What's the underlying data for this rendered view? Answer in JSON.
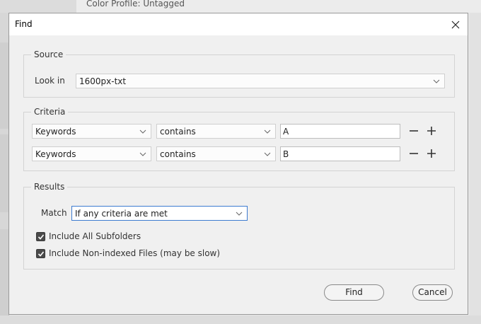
{
  "background": {
    "top_text": "Color Profile: Untagged"
  },
  "dialog": {
    "title": "Find",
    "close_icon": "close-icon",
    "source": {
      "legend": "Source",
      "look_in_label": "Look in",
      "look_in_value": "1600px-txt"
    },
    "criteria": {
      "legend": "Criteria",
      "rows": [
        {
          "field": "Keywords",
          "operator": "contains",
          "value": "A"
        },
        {
          "field": "Keywords",
          "operator": "contains",
          "value": "B"
        }
      ],
      "remove_icon": "minus-icon",
      "add_icon": "plus-icon"
    },
    "results": {
      "legend": "Results",
      "match_label": "Match",
      "match_value": "If any criteria are met",
      "include_subfolders": {
        "label": "Include All Subfolders",
        "checked": true
      },
      "include_nonindexed": {
        "label": "Include Non-indexed Files (may be slow)",
        "checked": true
      }
    },
    "buttons": {
      "find": "Find",
      "cancel": "Cancel"
    },
    "colors": {
      "focus_border": "#3d7bd0",
      "dialog_bg": "#f0f0f0",
      "titlebar_bg": "#ffffff"
    }
  }
}
